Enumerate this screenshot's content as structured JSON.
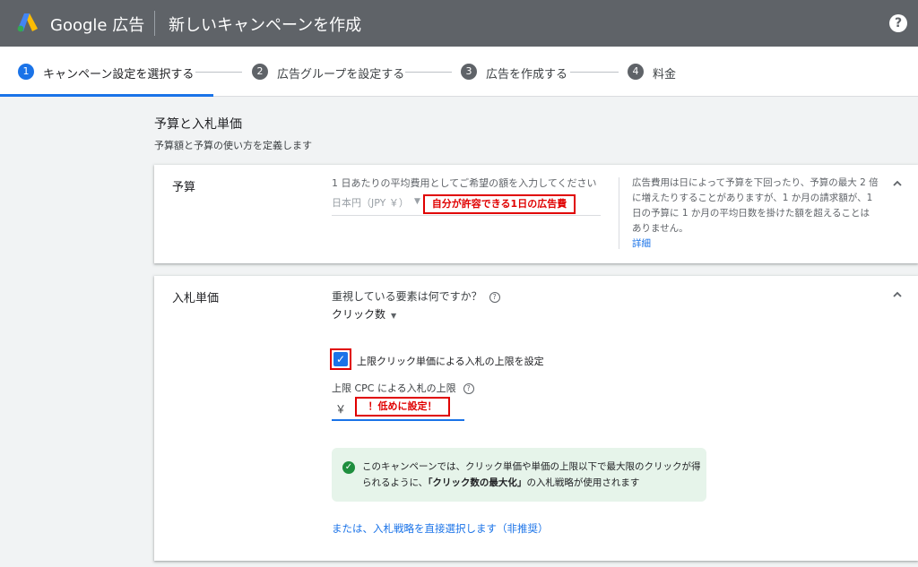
{
  "topbar": {
    "brand": "Google 広告",
    "title": "新しいキャンペーンを作成",
    "help_label": "?"
  },
  "steps": [
    {
      "num": "1",
      "label": "キャンペーン設定を選択する"
    },
    {
      "num": "2",
      "label": "広告グループを設定する"
    },
    {
      "num": "3",
      "label": "広告を作成する"
    },
    {
      "num": "4",
      "label": "料金"
    }
  ],
  "section": {
    "title": "予算と入札単価",
    "subtitle": "予算額と予算の使い方を定義します"
  },
  "budget": {
    "label": "予算",
    "instruction": "1 日あたりの平均費用としてご希望の額を入力してください",
    "currency": "日本円（JPY ￥）",
    "amount_annotation": "自分が許容できる1日の広告費",
    "note": "広告費用は日によって予算を下回ったり、予算の最大 2 倍に増えたりすることがありますが、1 か月の請求額が、1 日の予算に 1 か月の平均日数を掛けた額を超えることはありません。",
    "link": "詳細"
  },
  "bidding": {
    "label": "入札単価",
    "question": "重視している要素は何ですか？",
    "selected": "クリック数",
    "checkbox_label": "上限クリック単価による入札の上限を設定",
    "cpc_label": "上限 CPC による入札の上限",
    "currency_symbol": "￥",
    "cpc_annotation": "！低めに設定！",
    "info_pre": "このキャンペーンでは、クリック単価や単価の上限以下で最大限のクリックが得られるように、",
    "info_bold": "「クリック数の最大化」",
    "info_post": "の入札戦略が使用されます",
    "alt_link": "または、入札戦略を直接選択します（非推奨）"
  },
  "colors": {
    "topbar": "#5f6368",
    "accent": "#1a73e8",
    "annotation": "#e00000",
    "success": "#1e8e3e"
  }
}
